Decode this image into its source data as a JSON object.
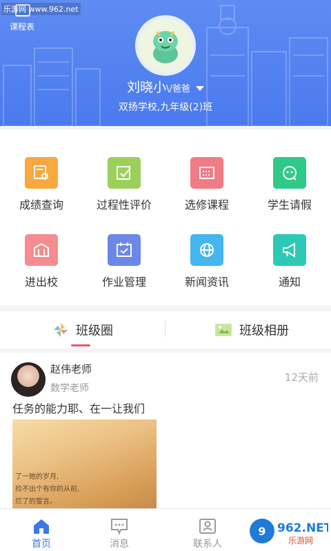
{
  "watermark": "乐游网 www.962.net",
  "header": {
    "schedule_label": "课程表",
    "user_name": "刘晓小",
    "user_role": "\\/爸爸",
    "school": "双扬学校,九年级(2)班",
    "bg_color": "#5b89f1"
  },
  "grid": {
    "items": [
      {
        "label": "成绩查询",
        "color": "#f7a83f",
        "icon": "grade-search-icon"
      },
      {
        "label": "过程性评价",
        "color": "#9bd15a",
        "icon": "evaluation-icon"
      },
      {
        "label": "选修课程",
        "color": "#f37b86",
        "icon": "elective-icon"
      },
      {
        "label": "学生请假",
        "color": "#2fc989",
        "icon": "leave-icon"
      },
      {
        "label": "进出校",
        "color": "#f48c90",
        "icon": "gate-icon"
      },
      {
        "label": "作业管理",
        "color": "#6b88e8",
        "icon": "homework-icon"
      },
      {
        "label": "新闻资讯",
        "color": "#44b6f0",
        "icon": "news-icon"
      },
      {
        "label": "通知",
        "color": "#2dc9b7",
        "icon": "notice-icon"
      }
    ]
  },
  "tabs": {
    "class_circle": "班级圈",
    "class_album": "班级相册"
  },
  "post": {
    "author": "赵伟老师",
    "subtitle": "数学老师",
    "time": "12天前",
    "content": "任务的能力耶、在一让我们",
    "image_lines": [
      "了一她的岁月,",
      "捡不出个有你的从前,",
      "烂了的誓言。"
    ]
  },
  "bottom_nav": {
    "items": [
      {
        "label": "首页",
        "active": true
      },
      {
        "label": "消息",
        "active": false
      },
      {
        "label": "联系人",
        "active": false
      }
    ]
  },
  "brand_badge": {
    "text": "962.NET",
    "sub": "乐游网"
  },
  "accent": "#3c79e6"
}
